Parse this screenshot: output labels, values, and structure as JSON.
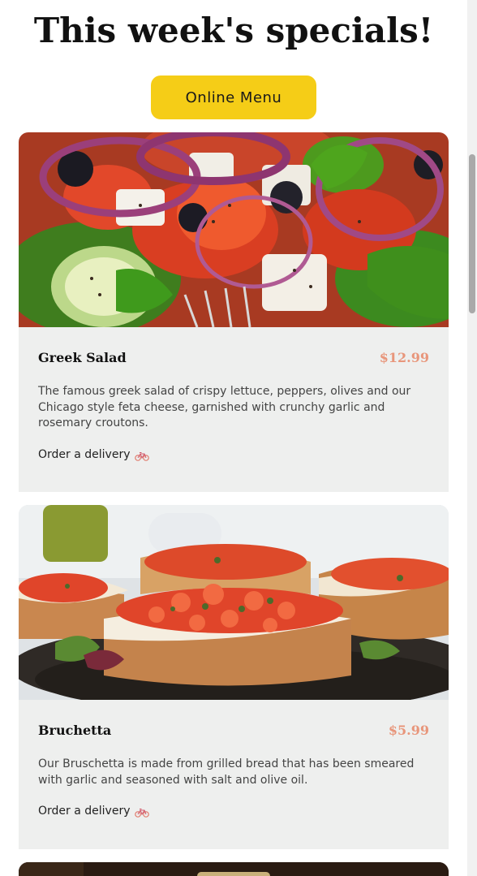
{
  "header": {
    "title": "This week's specials!",
    "menu_button_label": "Online Menu"
  },
  "specials": [
    {
      "name": "Greek Salad",
      "price": "$12.99",
      "description": "The famous greek salad of crispy lettuce, peppers, olives and our Chicago style feta cheese, garnished with crunchy garlic and rosemary croutons.",
      "order_label": "Order a delivery",
      "order_icon": "bicycle-icon"
    },
    {
      "name": "Bruchetta",
      "price": "$5.99",
      "description": "Our Bruschetta is made from grilled bread that has been smeared with garlic and seasoned with salt and olive oil.",
      "order_label": "Order a delivery",
      "order_icon": "bicycle-icon"
    }
  ],
  "colors": {
    "accent": "#f5cd17",
    "price": "#e8967b",
    "card_background": "#eeefee"
  }
}
